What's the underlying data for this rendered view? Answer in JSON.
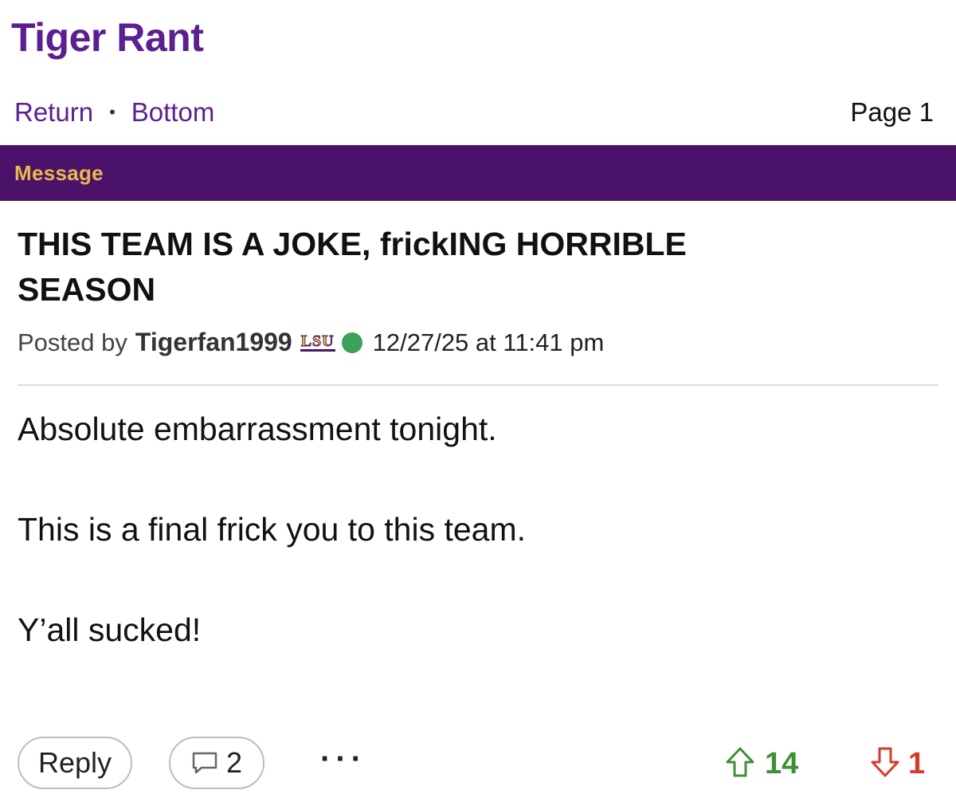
{
  "board": {
    "title": "Tiger Rant"
  },
  "nav": {
    "return_label": "Return",
    "separator": "•",
    "bottom_label": "Bottom",
    "page_label": "Page 1"
  },
  "section": {
    "label": "Message"
  },
  "post": {
    "title": "THIS TEAM IS A JOKE, frickING HORRIBLE SEASON",
    "posted_by_label": "Posted by",
    "author": "Tigerfan1999",
    "team_logo_text": "LSU",
    "online_status_color": "#3aa05a",
    "timestamp": "12/27/25 at 11:41 pm",
    "body": [
      "Absolute embarrassment tonight.",
      "This is a final frick you to this team.",
      "Y’all sucked!"
    ]
  },
  "actions": {
    "reply_label": "Reply",
    "comment_icon": "speech-bubble-icon",
    "comment_count": "2",
    "more_label": "···",
    "upvote_icon": "arrow-up-outline-icon",
    "upvotes": "14",
    "downvote_icon": "arrow-down-outline-icon",
    "downvotes": "1"
  },
  "colors": {
    "brand_purple": "#5b1f91",
    "bar_purple": "#4a1369",
    "gold": "#e8b84a",
    "upvote_green": "#3e8f35",
    "downvote_red": "#d83a2a"
  }
}
